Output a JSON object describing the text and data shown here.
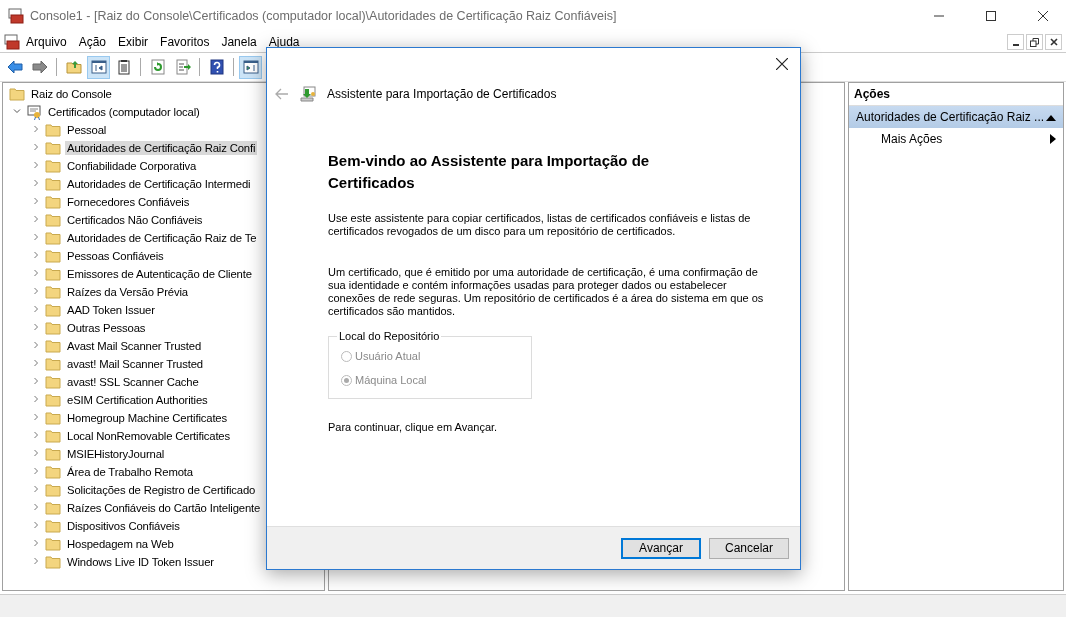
{
  "window": {
    "title": "Console1 - [Raiz do Console\\Certificados (computador local)\\Autoridades de Certificação Raiz Confiáveis]"
  },
  "menu": [
    "Arquivo",
    "Ação",
    "Exibir",
    "Favoritos",
    "Janela",
    "Ajuda"
  ],
  "toolbar": [
    {
      "kind": "back",
      "pressed": false
    },
    {
      "kind": "forward",
      "pressed": false
    },
    {
      "kind": "up",
      "pressed": false
    },
    {
      "kind": "tree",
      "pressed": true
    },
    {
      "kind": "properties",
      "pressed": false
    },
    {
      "kind": "refresh",
      "pressed": false
    },
    {
      "kind": "export",
      "pressed": false
    },
    {
      "kind": "help",
      "pressed": false
    },
    {
      "kind": "actionpane",
      "pressed": true
    }
  ],
  "tree": {
    "label": "Raiz do Console",
    "selected": false,
    "children": [
      {
        "label": "Certificados (computador local)",
        "expanded": true,
        "selected": false,
        "children": [
          {
            "label": "Pessoal",
            "expanded": false,
            "selected": false
          },
          {
            "label": "Autoridades de Certificação Raiz Confi",
            "expanded": false,
            "selected": true
          },
          {
            "label": "Confiabilidade Corporativa",
            "expanded": false,
            "selected": false
          },
          {
            "label": "Autoridades de Certificação Intermedi",
            "expanded": false,
            "selected": false
          },
          {
            "label": "Fornecedores Confiáveis",
            "expanded": false,
            "selected": false
          },
          {
            "label": "Certificados Não Confiáveis",
            "expanded": false,
            "selected": false
          },
          {
            "label": "Autoridades de Certificação Raiz de Te",
            "expanded": false,
            "selected": false
          },
          {
            "label": "Pessoas Confiáveis",
            "expanded": false,
            "selected": false
          },
          {
            "label": "Emissores de Autenticação de Cliente",
            "expanded": false,
            "selected": false
          },
          {
            "label": "Raízes da Versão Prévia",
            "expanded": false,
            "selected": false
          },
          {
            "label": "AAD Token Issuer",
            "expanded": false,
            "selected": false
          },
          {
            "label": "Outras Pessoas",
            "expanded": false,
            "selected": false
          },
          {
            "label": "Avast Mail Scanner Trusted",
            "expanded": false,
            "selected": false
          },
          {
            "label": "avast! Mail Scanner Trusted",
            "expanded": false,
            "selected": false
          },
          {
            "label": "avast! SSL Scanner Cache",
            "expanded": false,
            "selected": false
          },
          {
            "label": "eSIM Certification Authorities",
            "expanded": false,
            "selected": false
          },
          {
            "label": "Homegroup Machine Certificates",
            "expanded": false,
            "selected": false
          },
          {
            "label": "Local NonRemovable Certificates",
            "expanded": false,
            "selected": false
          },
          {
            "label": "MSIEHistoryJournal",
            "expanded": false,
            "selected": false
          },
          {
            "label": "Área de Trabalho Remota",
            "expanded": false,
            "selected": false
          },
          {
            "label": "Solicitações de Registro de Certificado",
            "expanded": false,
            "selected": false
          },
          {
            "label": "Raízes Confiáveis do Cartão Inteligente",
            "expanded": false,
            "selected": false
          },
          {
            "label": "Dispositivos Confiáveis",
            "expanded": false,
            "selected": false
          },
          {
            "label": "Hospedagem na Web",
            "expanded": false,
            "selected": false
          },
          {
            "label": "Windows Live ID Token Issuer",
            "expanded": false,
            "selected": false
          }
        ]
      }
    ]
  },
  "actions": {
    "title": "Ações",
    "section": {
      "label": "Autoridades de Certificação Raiz ...",
      "expanded": true
    },
    "items": [
      {
        "label": "Mais Ações"
      }
    ]
  },
  "dialog": {
    "title": "Assistente para Importação de Certificados",
    "heading": "Bem-vindo ao Assistente para Importação de Certificados",
    "paragraphs": [
      "Use este assistente para copiar certificados, listas de certificados confiáveis e listas de certificados revogados de um disco para um repositório de certificados.",
      "Um certificado, que é emitido por uma autoridade de certificação, é uma confirmação de sua identidade e contém informações usadas para proteger dados ou estabelecer conexões de rede seguras. Um repositório de certificados é a área do sistema em que os certificados são mantidos."
    ],
    "store_location": {
      "legend": "Local do Repositório",
      "disabled": true,
      "options": [
        {
          "label": "Usuário Atual",
          "selected": false
        },
        {
          "label": "Máquina Local",
          "selected": true
        }
      ]
    },
    "footer_text": "Para continuar, clique em Avançar.",
    "buttons": [
      {
        "label": "Avançar",
        "default": true
      },
      {
        "label": "Cancelar",
        "default": false
      }
    ]
  }
}
